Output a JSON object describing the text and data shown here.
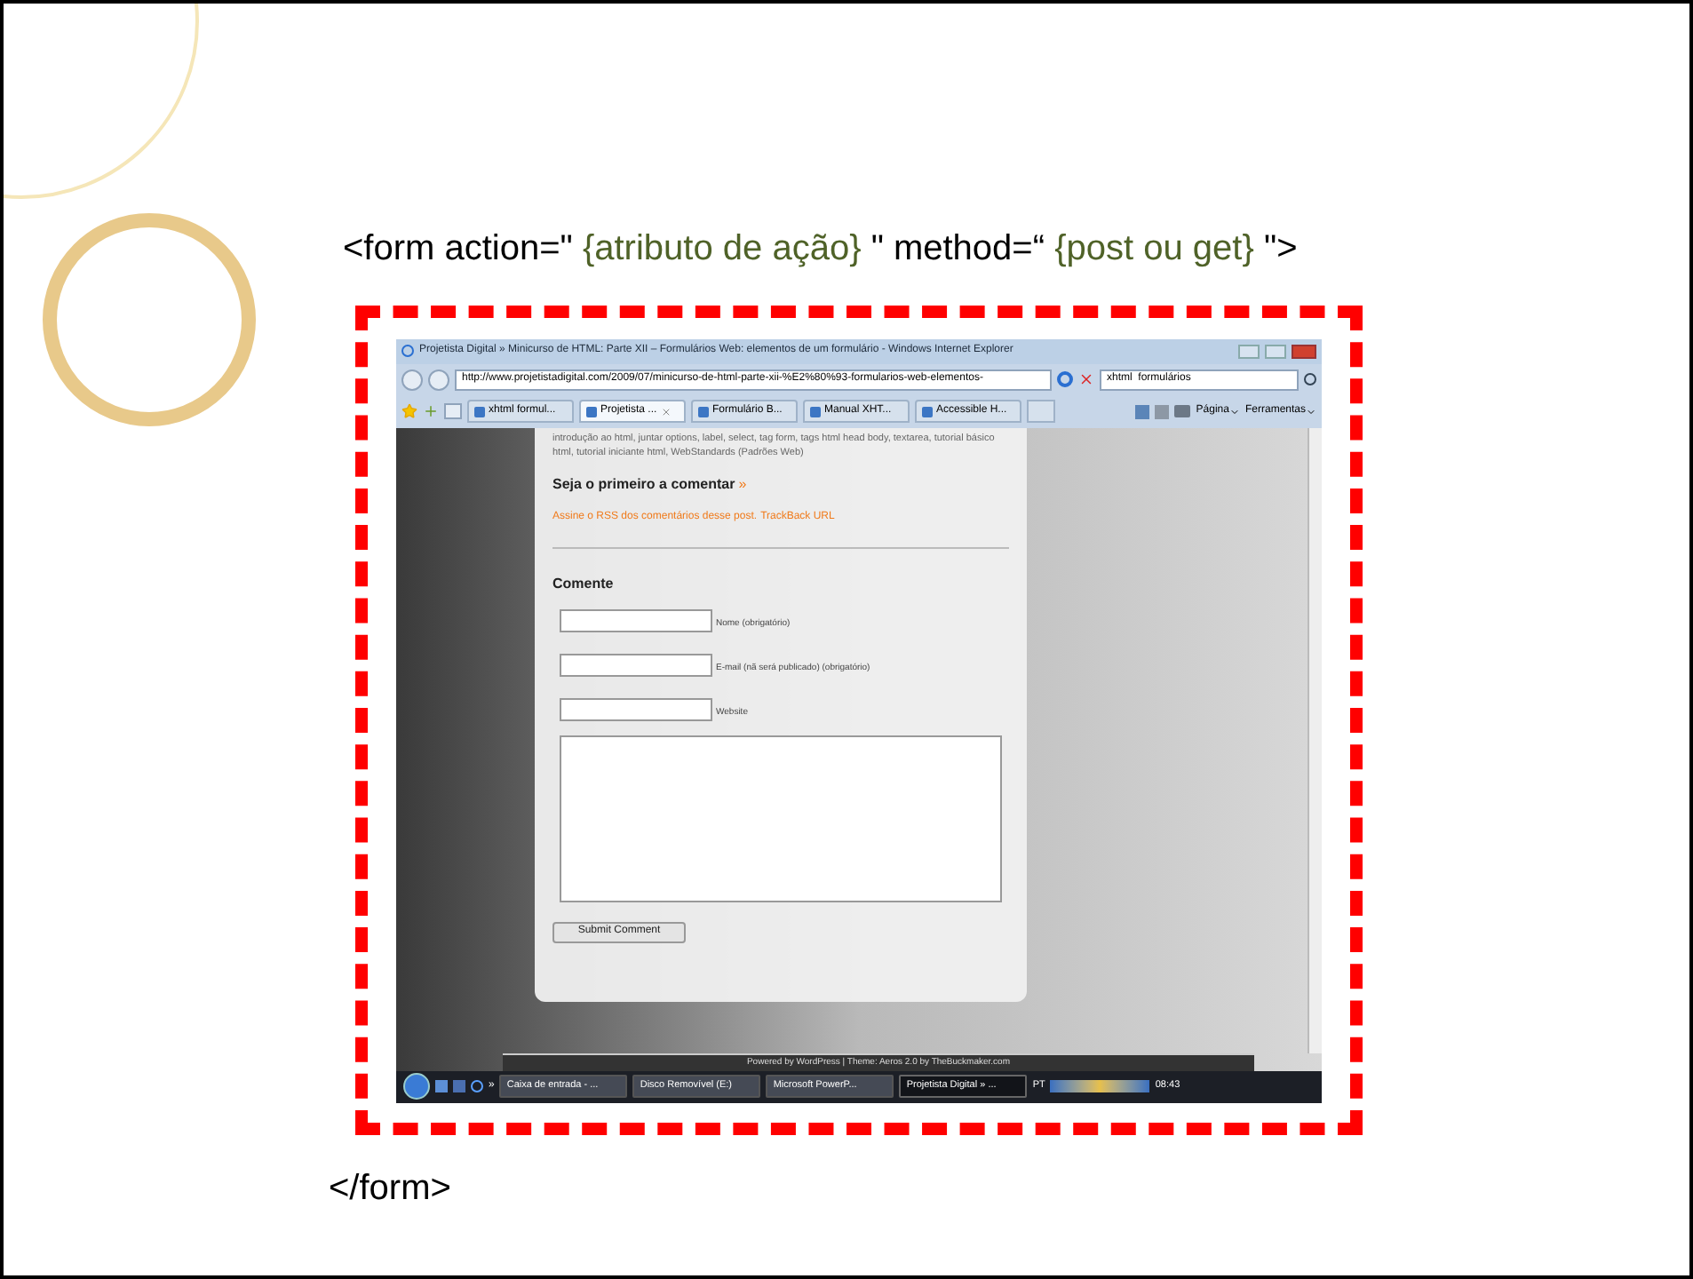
{
  "slide": {
    "code_open": [
      {
        "kind": "code",
        "text": "<form action=\""
      },
      {
        "kind": "value",
        "text": " {atributo de ação} "
      },
      {
        "kind": "code",
        "text": "\" method=“"
      },
      {
        "kind": "value",
        "text": " {post ou get} "
      },
      {
        "kind": "code",
        "text": "\">"
      }
    ],
    "code_close": "</form>"
  },
  "browser": {
    "title": "Projetista Digital » Minicurso de HTML: Parte XII – Formulários Web: elementos de um formulário - Windows Internet Explorer",
    "address": "http://www.projetistadigital.com/2009/07/minicurso-de-html-parte-xii-%E2%80%93-formularios-web-elementos-",
    "search": "xhtml  formulários",
    "tabs": [
      {
        "label": "xhtml formul...",
        "selected": false
      },
      {
        "label": "Projetista ...",
        "selected": true
      },
      {
        "label": "Formulário B...",
        "selected": false
      },
      {
        "label": "Manual XHT...",
        "selected": false
      },
      {
        "label": "Accessible H...",
        "selected": false
      }
    ],
    "tools": [
      "Página",
      "Ferramentas"
    ]
  },
  "page": {
    "tags_text": "introdução ao html, juntar options, label, select, tag form, tags html head body, textarea, tutorial básico html, tutorial iniciante html, WebStandards (Padrões Web)",
    "comments_heading": "Seja o primeiro a comentar",
    "comments_arrow": "»",
    "rss_link": "Assine o RSS dos comentários desse post.",
    "trackback_link": "TrackBack URL",
    "form_heading": "Comente",
    "fields": [
      {
        "label": "Nome (obrigatório)"
      },
      {
        "label": "E-mail (nã será publicado) (obrigatório)"
      },
      {
        "label": "Website"
      }
    ],
    "submit": "Submit Comment",
    "footer": "Powered by WordPress | Theme: Aeros 2.0 by TheBuckmaker.com"
  },
  "taskbar": {
    "overflow": "»",
    "items": [
      {
        "label": "Caixa de entrada - ...",
        "selected": false
      },
      {
        "label": "Disco Removível (E:)",
        "selected": false
      },
      {
        "label": "Microsoft PowerP...",
        "selected": false
      },
      {
        "label": "Projetista Digital » ...",
        "selected": true
      }
    ],
    "language": "PT",
    "clock": "08:43"
  }
}
